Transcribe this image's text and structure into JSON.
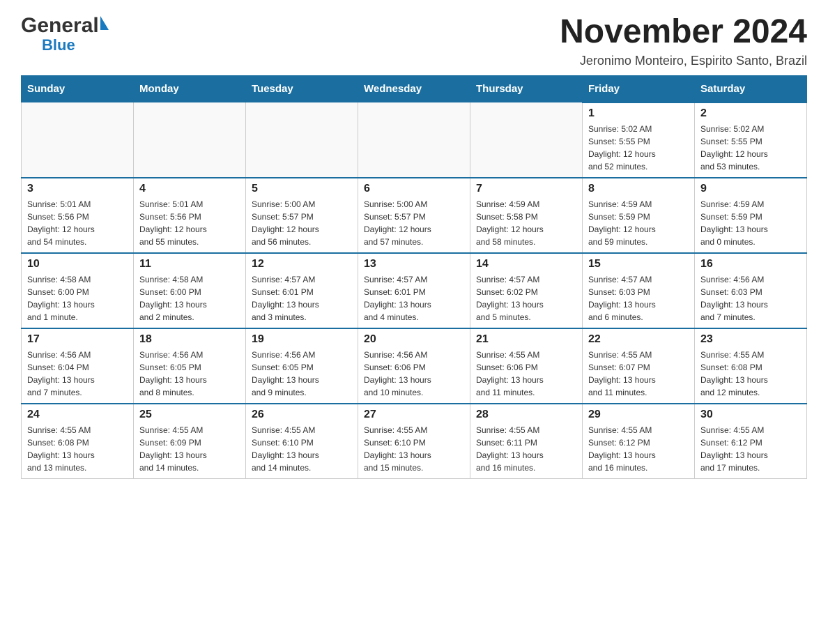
{
  "logo": {
    "general": "General",
    "blue": "Blue"
  },
  "title": "November 2024",
  "location": "Jeronimo Monteiro, Espirito Santo, Brazil",
  "days_of_week": [
    "Sunday",
    "Monday",
    "Tuesday",
    "Wednesday",
    "Thursday",
    "Friday",
    "Saturday"
  ],
  "weeks": [
    {
      "cells": [
        {
          "day": "",
          "info": ""
        },
        {
          "day": "",
          "info": ""
        },
        {
          "day": "",
          "info": ""
        },
        {
          "day": "",
          "info": ""
        },
        {
          "day": "",
          "info": ""
        },
        {
          "day": "1",
          "info": "Sunrise: 5:02 AM\nSunset: 5:55 PM\nDaylight: 12 hours\nand 52 minutes."
        },
        {
          "day": "2",
          "info": "Sunrise: 5:02 AM\nSunset: 5:55 PM\nDaylight: 12 hours\nand 53 minutes."
        }
      ]
    },
    {
      "cells": [
        {
          "day": "3",
          "info": "Sunrise: 5:01 AM\nSunset: 5:56 PM\nDaylight: 12 hours\nand 54 minutes."
        },
        {
          "day": "4",
          "info": "Sunrise: 5:01 AM\nSunset: 5:56 PM\nDaylight: 12 hours\nand 55 minutes."
        },
        {
          "day": "5",
          "info": "Sunrise: 5:00 AM\nSunset: 5:57 PM\nDaylight: 12 hours\nand 56 minutes."
        },
        {
          "day": "6",
          "info": "Sunrise: 5:00 AM\nSunset: 5:57 PM\nDaylight: 12 hours\nand 57 minutes."
        },
        {
          "day": "7",
          "info": "Sunrise: 4:59 AM\nSunset: 5:58 PM\nDaylight: 12 hours\nand 58 minutes."
        },
        {
          "day": "8",
          "info": "Sunrise: 4:59 AM\nSunset: 5:59 PM\nDaylight: 12 hours\nand 59 minutes."
        },
        {
          "day": "9",
          "info": "Sunrise: 4:59 AM\nSunset: 5:59 PM\nDaylight: 13 hours\nand 0 minutes."
        }
      ]
    },
    {
      "cells": [
        {
          "day": "10",
          "info": "Sunrise: 4:58 AM\nSunset: 6:00 PM\nDaylight: 13 hours\nand 1 minute."
        },
        {
          "day": "11",
          "info": "Sunrise: 4:58 AM\nSunset: 6:00 PM\nDaylight: 13 hours\nand 2 minutes."
        },
        {
          "day": "12",
          "info": "Sunrise: 4:57 AM\nSunset: 6:01 PM\nDaylight: 13 hours\nand 3 minutes."
        },
        {
          "day": "13",
          "info": "Sunrise: 4:57 AM\nSunset: 6:01 PM\nDaylight: 13 hours\nand 4 minutes."
        },
        {
          "day": "14",
          "info": "Sunrise: 4:57 AM\nSunset: 6:02 PM\nDaylight: 13 hours\nand 5 minutes."
        },
        {
          "day": "15",
          "info": "Sunrise: 4:57 AM\nSunset: 6:03 PM\nDaylight: 13 hours\nand 6 minutes."
        },
        {
          "day": "16",
          "info": "Sunrise: 4:56 AM\nSunset: 6:03 PM\nDaylight: 13 hours\nand 7 minutes."
        }
      ]
    },
    {
      "cells": [
        {
          "day": "17",
          "info": "Sunrise: 4:56 AM\nSunset: 6:04 PM\nDaylight: 13 hours\nand 7 minutes."
        },
        {
          "day": "18",
          "info": "Sunrise: 4:56 AM\nSunset: 6:05 PM\nDaylight: 13 hours\nand 8 minutes."
        },
        {
          "day": "19",
          "info": "Sunrise: 4:56 AM\nSunset: 6:05 PM\nDaylight: 13 hours\nand 9 minutes."
        },
        {
          "day": "20",
          "info": "Sunrise: 4:56 AM\nSunset: 6:06 PM\nDaylight: 13 hours\nand 10 minutes."
        },
        {
          "day": "21",
          "info": "Sunrise: 4:55 AM\nSunset: 6:06 PM\nDaylight: 13 hours\nand 11 minutes."
        },
        {
          "day": "22",
          "info": "Sunrise: 4:55 AM\nSunset: 6:07 PM\nDaylight: 13 hours\nand 11 minutes."
        },
        {
          "day": "23",
          "info": "Sunrise: 4:55 AM\nSunset: 6:08 PM\nDaylight: 13 hours\nand 12 minutes."
        }
      ]
    },
    {
      "cells": [
        {
          "day": "24",
          "info": "Sunrise: 4:55 AM\nSunset: 6:08 PM\nDaylight: 13 hours\nand 13 minutes."
        },
        {
          "day": "25",
          "info": "Sunrise: 4:55 AM\nSunset: 6:09 PM\nDaylight: 13 hours\nand 14 minutes."
        },
        {
          "day": "26",
          "info": "Sunrise: 4:55 AM\nSunset: 6:10 PM\nDaylight: 13 hours\nand 14 minutes."
        },
        {
          "day": "27",
          "info": "Sunrise: 4:55 AM\nSunset: 6:10 PM\nDaylight: 13 hours\nand 15 minutes."
        },
        {
          "day": "28",
          "info": "Sunrise: 4:55 AM\nSunset: 6:11 PM\nDaylight: 13 hours\nand 16 minutes."
        },
        {
          "day": "29",
          "info": "Sunrise: 4:55 AM\nSunset: 6:12 PM\nDaylight: 13 hours\nand 16 minutes."
        },
        {
          "day": "30",
          "info": "Sunrise: 4:55 AM\nSunset: 6:12 PM\nDaylight: 13 hours\nand 17 minutes."
        }
      ]
    }
  ]
}
